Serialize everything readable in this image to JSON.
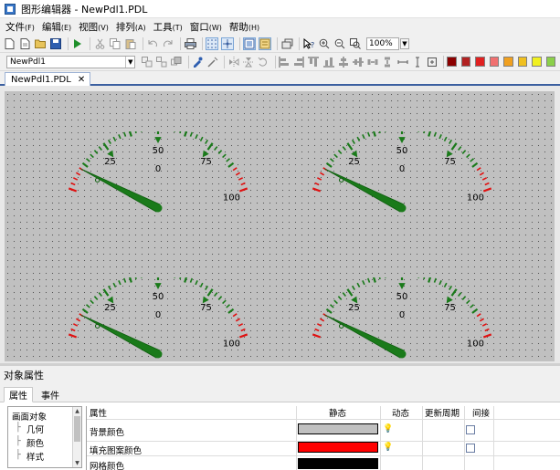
{
  "window": {
    "title": "图形编辑器 - NewPdl1.PDL"
  },
  "menu": [
    {
      "label": "文件",
      "hotkey": "(F)"
    },
    {
      "label": "编辑",
      "hotkey": "(E)"
    },
    {
      "label": "视图",
      "hotkey": "(V)"
    },
    {
      "label": "排列",
      "hotkey": "(A)"
    },
    {
      "label": "工具",
      "hotkey": "(T)"
    },
    {
      "label": "窗口",
      "hotkey": "(W)"
    },
    {
      "label": "帮助",
      "hotkey": "(H)"
    }
  ],
  "toolbar": {
    "zoom": "100%"
  },
  "toolbar2": {
    "object_select": "NewPdl1",
    "colors": [
      "#8b0000",
      "#b22222",
      "#e02020",
      "#f07070",
      "#f0a020",
      "#f0c020",
      "#f0f020",
      "#8bd04a"
    ]
  },
  "document_tab": {
    "label": "NewPdl1.PDL",
    "close": "✕"
  },
  "gauge": {
    "tick_labels": [
      "0",
      "25",
      "50",
      "75",
      "100"
    ],
    "needle_value": 10,
    "scale_color": "#1a7a1a",
    "danger_color": "#e01010"
  },
  "panel": {
    "title": "对象属性",
    "tabs": [
      "属性",
      "事件"
    ],
    "tree": [
      "画面对象",
      "几何",
      "颜色",
      "样式"
    ],
    "columns": [
      "属性",
      "静态",
      "动态",
      "更新周期",
      "间接"
    ],
    "rows": [
      {
        "name": "背景颜色",
        "color": "#c0c0c0"
      },
      {
        "name": "填充图案颜色",
        "color": "#ff0000"
      },
      {
        "name": "网格颜色",
        "color": "#000000"
      }
    ]
  }
}
